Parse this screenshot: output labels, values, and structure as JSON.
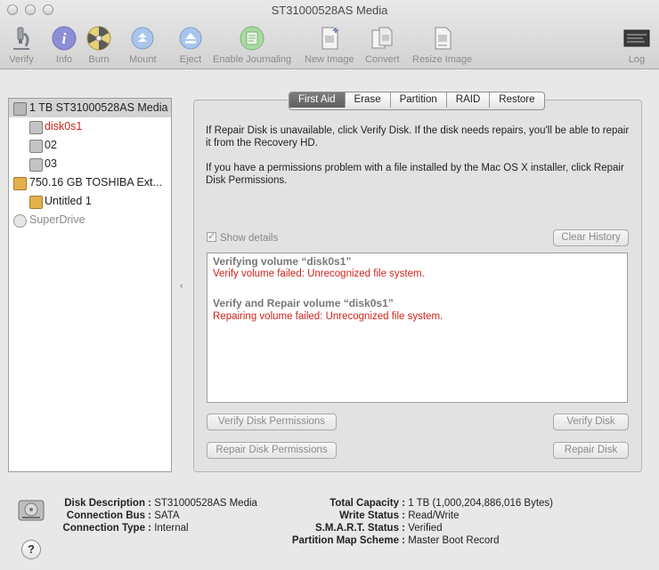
{
  "window": {
    "title": "ST31000528AS Media"
  },
  "toolbar": {
    "items": [
      {
        "label": "Verify",
        "icon": "microscope-icon"
      },
      {
        "label": "Info",
        "icon": "info-icon"
      },
      {
        "label": "Burn",
        "icon": "burn-icon"
      },
      {
        "label": "Mount",
        "icon": "mount-icon"
      },
      {
        "label": "Eject",
        "icon": "eject-icon"
      },
      {
        "label": "Enable Journaling",
        "icon": "journaling-icon"
      },
      {
        "label": "New Image",
        "icon": "new-image-icon"
      },
      {
        "label": "Convert",
        "icon": "convert-icon"
      },
      {
        "label": "Resize Image",
        "icon": "resize-image-icon"
      },
      {
        "label": "Log",
        "icon": "log-icon"
      }
    ]
  },
  "sidebar": {
    "items": [
      {
        "label": "1 TB ST31000528AS Media",
        "selected": true
      },
      {
        "label": "disk0s1",
        "color": "#d0221b"
      },
      {
        "label": "02"
      },
      {
        "label": "03"
      },
      {
        "label": "750.16 GB TOSHIBA Ext..."
      },
      {
        "label": "Untitled 1"
      },
      {
        "label": "SuperDrive",
        "color": "#8a8a8a"
      }
    ]
  },
  "tabs": {
    "items": [
      "First Aid",
      "Erase",
      "Partition",
      "RAID",
      "Restore"
    ],
    "active": "First Aid"
  },
  "first_aid": {
    "info_1": "If Repair Disk is unavailable, click Verify Disk. If the disk needs repairs, you'll be able to repair it from the Recovery HD.",
    "info_2": "If you have a permissions problem with a file installed by the Mac OS X installer, click Repair Disk Permissions.",
    "show_details_label": "Show details",
    "show_details_checked": true,
    "clear_history": "Clear History",
    "log": [
      {
        "heading": "Verifying volume “disk0s1”",
        "error": "Verify volume failed: Unrecognized file system."
      },
      {
        "heading": "Verify and Repair volume “disk0s1”",
        "error": "Repairing volume failed: Unrecognized file system."
      }
    ],
    "buttons": {
      "verify_permissions": "Verify Disk Permissions",
      "repair_permissions": "Repair Disk Permissions",
      "verify_disk": "Verify Disk",
      "repair_disk": "Repair Disk"
    }
  },
  "details": {
    "left": [
      {
        "key": "Disk Description :",
        "value": "ST31000528AS Media"
      },
      {
        "key": "Connection Bus :",
        "value": "SATA"
      },
      {
        "key": "Connection Type :",
        "value": "Internal"
      }
    ],
    "right": [
      {
        "key": "Total Capacity :",
        "value": "1 TB (1,000,204,886,016 Bytes)"
      },
      {
        "key": "Write Status :",
        "value": "Read/Write"
      },
      {
        "key": "S.M.A.R.T. Status :",
        "value": "Verified"
      },
      {
        "key": "Partition Map Scheme :",
        "value": "Master Boot Record"
      }
    ]
  },
  "help": {
    "label": "?"
  },
  "splitter": {
    "glyph": "‹"
  },
  "colors": {
    "error": "#d0221b",
    "tab_active": "#6a6a6a",
    "disabled_text": "#8a8a8a"
  }
}
